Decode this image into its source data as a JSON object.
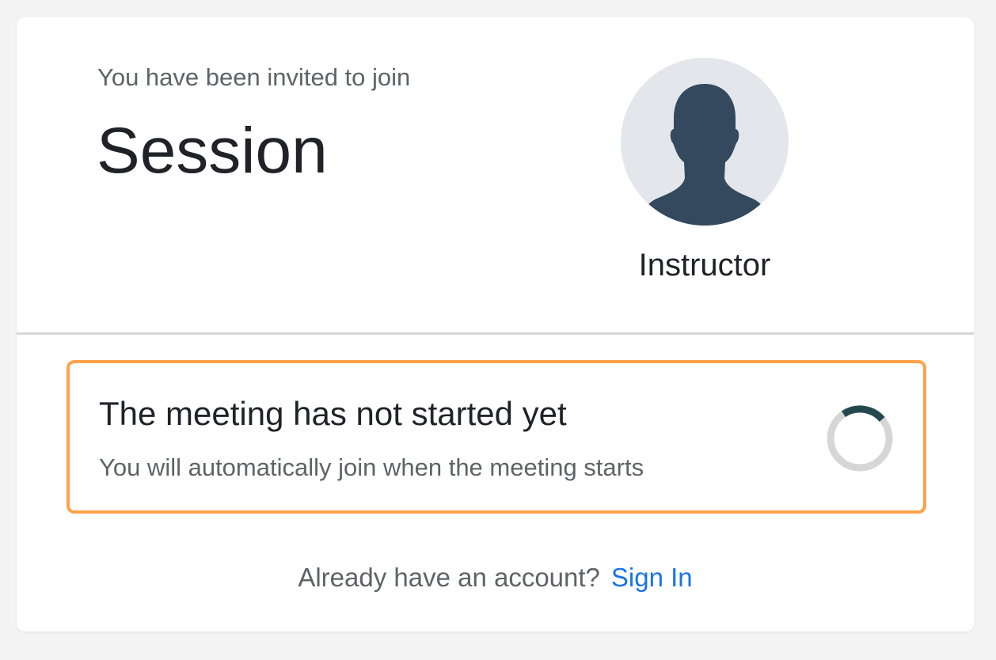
{
  "invite": {
    "intro": "You have been invited to join",
    "session_name": "Session"
  },
  "host": {
    "avatar_icon": "person-silhouette-icon",
    "role_label": "Instructor"
  },
  "status": {
    "title": "The meeting has not started yet",
    "subtitle": "You will automatically join when the meeting starts",
    "spinner_icon": "loading-spinner-icon"
  },
  "account": {
    "prompt": "Already have an account?",
    "signin_label": "Sign In"
  },
  "colors": {
    "page_background": "#f4f4f4",
    "card_background": "#ffffff",
    "status_border": "#ffa24c",
    "link": "#1a73e8",
    "avatar_background": "#e3e7ec",
    "avatar_silhouette": "#34495e",
    "spinner_track": "#d6d6d6",
    "spinner_arc": "#25484f"
  }
}
